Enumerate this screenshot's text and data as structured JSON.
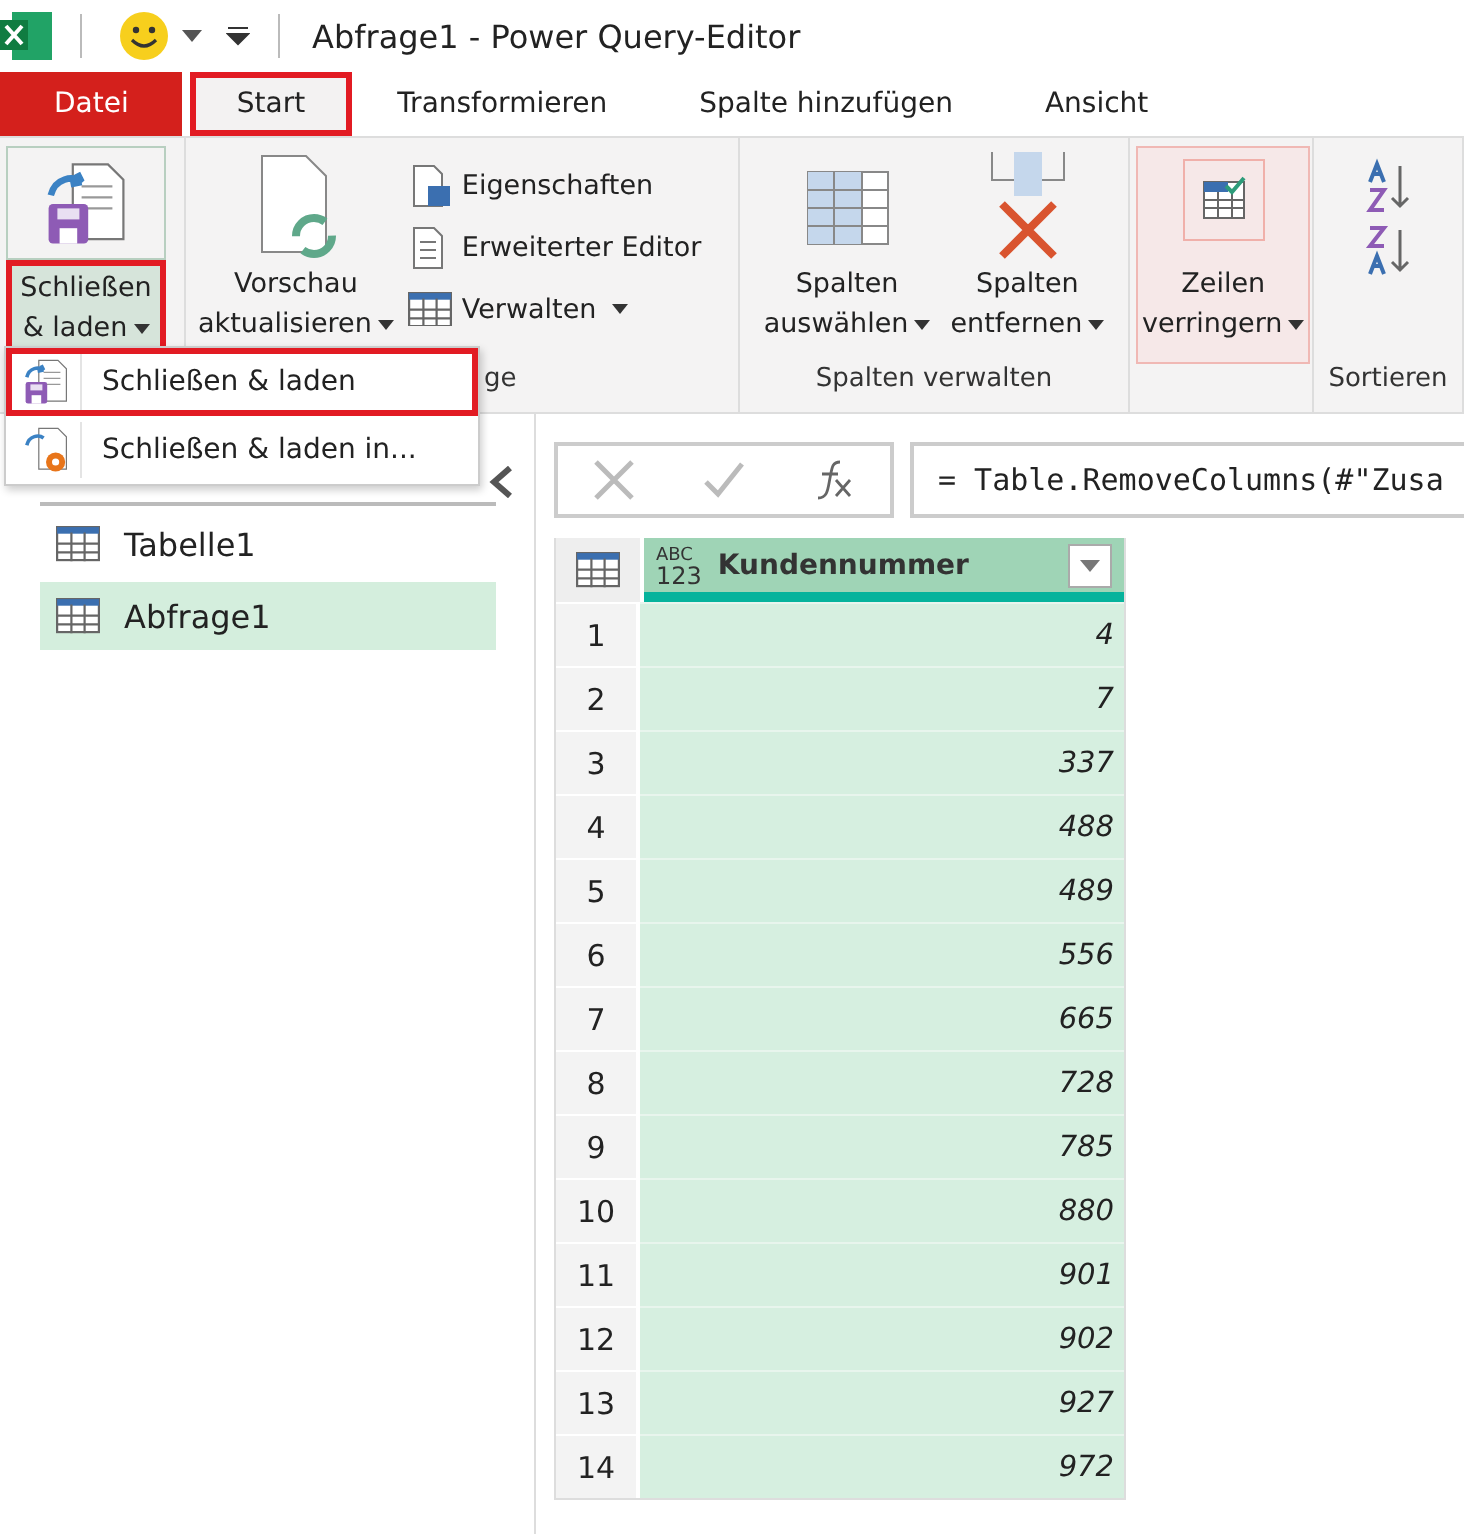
{
  "window": {
    "title": "Abfrage1 - Power Query-Editor"
  },
  "tabs": [
    {
      "label": "Datei",
      "kind": "file",
      "highlighted": false
    },
    {
      "label": "Start",
      "kind": "tab",
      "selected": true,
      "highlighted": true
    },
    {
      "label": "Transformieren",
      "kind": "tab",
      "selected": false,
      "highlighted": false
    },
    {
      "label": "Spalte hinzufügen",
      "kind": "tab",
      "selected": false,
      "highlighted": false
    },
    {
      "label": "Ansicht",
      "kind": "tab",
      "selected": false,
      "highlighted": false
    }
  ],
  "ribbon": {
    "close_load": {
      "lines": [
        "Schließen",
        "& laden"
      ],
      "highlighted": true
    },
    "refresh": {
      "lines": [
        "Vorschau",
        "aktualisieren"
      ]
    },
    "query_actions": [
      "Eigenschaften",
      "Erweiterter Editor",
      "Verwalten"
    ],
    "query_group_label": "ge",
    "choose_columns": [
      "Spalten",
      "auswählen"
    ],
    "remove_columns": [
      "Spalten",
      "entfernen"
    ],
    "columns_group_label": "Spalten verwalten",
    "reduce_rows": {
      "lines": [
        "Zeilen",
        "verringern"
      ],
      "hovered": true
    },
    "sort_group_label": "Sortieren"
  },
  "menu": {
    "items": [
      {
        "label": "Schließen & laden",
        "highlighted": true
      },
      {
        "label": "Schließen & laden in...",
        "highlighted": false
      }
    ]
  },
  "queries": [
    {
      "name": "Tabelle1",
      "selected": false
    },
    {
      "name": "Abfrage1",
      "selected": true
    }
  ],
  "formula": "= Table.RemoveColumns(#\"Zusa",
  "table": {
    "type_badge": [
      "ABC",
      "123"
    ],
    "column": "Kundennummer",
    "rows": [
      [
        "1",
        "4"
      ],
      [
        "2",
        "7"
      ],
      [
        "3",
        "337"
      ],
      [
        "4",
        "488"
      ],
      [
        "5",
        "489"
      ],
      [
        "6",
        "556"
      ],
      [
        "7",
        "665"
      ],
      [
        "8",
        "728"
      ],
      [
        "9",
        "785"
      ],
      [
        "10",
        "880"
      ],
      [
        "11",
        "901"
      ],
      [
        "12",
        "902"
      ],
      [
        "13",
        "927"
      ],
      [
        "14",
        "972"
      ]
    ]
  }
}
